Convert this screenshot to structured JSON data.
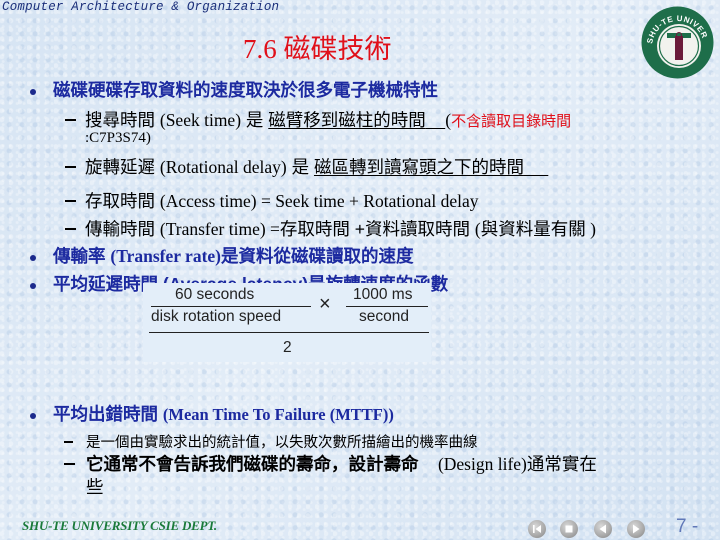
{
  "header": {
    "course": "Computer Architecture & Organization",
    "title": "7.6 磁碟技術",
    "logo_text": "SHU-TE UNIVERSITY",
    "logo_letter": "T"
  },
  "colors": {
    "title": "#e0101a",
    "bullet_level1": "#1c2aa0",
    "footer": "#1a7a3a",
    "logo_ring": "#1e6e4a",
    "logo_letter": "#6b1a3a"
  },
  "content": {
    "b1": {
      "text": "磁碟硬碟存取資料的速度取決於很多電子機械特性",
      "items": {
        "seek": {
          "term": "搜尋時間",
          "en": "(Seek time)",
          "is": "是",
          "def": "磁臂移到磁柱的時間",
          "paren_open": "(",
          "note": "不含讀取目錄時間",
          "note_cont": ":C7P3S74)"
        },
        "rot": {
          "term": "旋轉延遲",
          "en": "(Rotational delay)",
          "is": "是",
          "def": "磁區轉到讀寫頭之下的時間"
        },
        "access": {
          "term": "存取時間",
          "en": "(Access time) = Seek time + Rotational delay"
        },
        "transfer": {
          "term": "傳輸時間",
          "en": "(Transfer time) =",
          "rest": "存取時間 +資料讀取時間",
          "note": "(與資料量有關 )"
        }
      }
    },
    "b2": {
      "term": "傳輸率",
      "en": "(Transfer rate)",
      "rest": "是資料從磁碟讀取的速度"
    },
    "b3": {
      "text": "平均延遲時間 (Average latency)是旋轉速度的函數"
    },
    "formula": {
      "num1": "60 seconds",
      "den1": "disk rotation speed",
      "times": "×",
      "num2": "1000 ms",
      "den2": "second",
      "divisor": "2"
    },
    "b4": {
      "term": "平均出錯時間",
      "en": "(Mean Time To Failure (MTTF))",
      "items": {
        "i1": "是一個由實驗求出的統計值，以失敗次數所描繪出的機率曲線",
        "i2_a": "它通常不會告訴我們磁碟的壽命，設計壽命",
        "i2_en": "(Design life)",
        "i2_b": "通常實在",
        "i2_c": "些"
      }
    }
  },
  "footer": {
    "dept": "SHU-TE UNIVERSITY  CSIE DEPT.",
    "page": "7 -",
    "nav": [
      "first-slide",
      "end-show",
      "previous-slide",
      "next-slide"
    ]
  }
}
